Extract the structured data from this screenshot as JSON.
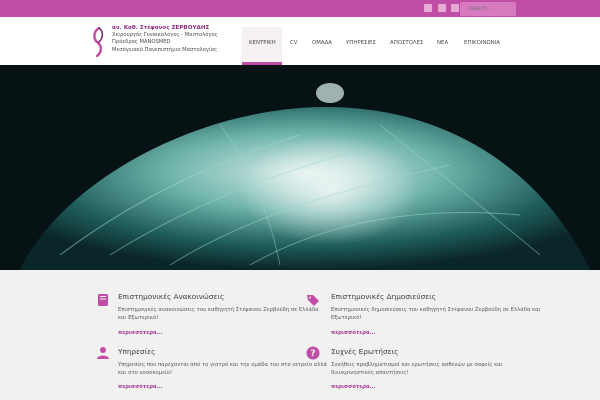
{
  "header": {
    "name": "αν. Καθ. Στέφανος ΖΕΡΒΟΥΔΗΣ",
    "line1": "Χειρουργός  Γυναικολόγος - Μαστολόγος",
    "line2": "Πρόεδρος MANOSMED",
    "line3": "Μεσόγειακό Πανεπιστήμιο Μαστολογίας"
  },
  "topbar": {
    "search_placeholder": "Search ..."
  },
  "nav": [
    {
      "label": "ΚΕΝΤΡΙΚΗ",
      "active": true
    },
    {
      "label": "CV"
    },
    {
      "label": "ΟΜΑΔΑ"
    },
    {
      "label": "ΥΠΗΡΕΣΙΕΣ"
    },
    {
      "label": "ΑΠΟΣΤΟΛΕΣ"
    },
    {
      "label": "ΝΕΑ"
    },
    {
      "label": "ΕΠΙΚΟΙΝΩΝΙΑ"
    }
  ],
  "features": [
    {
      "title": "Επιστημονικές Ανακοινώσεις",
      "text": "Επιστημονικές ανακοινώσεις του καθηγητή Στέφανου Ζερβούδη σε Ελλάδα και Εξωτερικό!",
      "more": "περισσότερα...",
      "icon": "book-icon"
    },
    {
      "title": "Επιστημονικές Δημοσιεύσεις",
      "text": "Επιστημονικές δημοσιεύσεις του καθηγητή Στέφανου Ζερβούδη σε Ελλάδα και Εξωτερικό!",
      "more": "περισσότερα...",
      "icon": "tags-icon"
    },
    {
      "title": "Υπηρεσίες",
      "text": "Υπηρεσίες που παρέχονται από το γιατρό και την ομάδα του στο ιατρείο αλλά και στο νοσοκομείο!",
      "more": "περισσότερα...",
      "icon": "user-icon"
    },
    {
      "title": "Συχνές Ερωτήσεις",
      "text": "Συνήθεις προβληματισμοί και ερωτήσεις ασθενών με σαφείς και διευκρινηστικές απαντήσεις!",
      "more": "περισσότερα...",
      "icon": "question-icon"
    }
  ],
  "colors": {
    "brand": "#c04ea6",
    "link": "#a53d93"
  }
}
